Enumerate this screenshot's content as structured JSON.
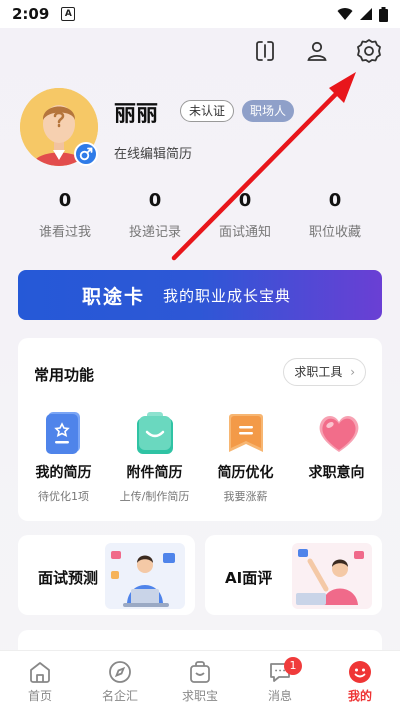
{
  "status": {
    "time": "2:09",
    "notification_letter": "A"
  },
  "header": {
    "icons": [
      "scan-icon",
      "user-icon",
      "settings-icon"
    ]
  },
  "profile": {
    "name": "丽丽",
    "tag_unverified": "未认证",
    "tag_pro": "职场人",
    "edit_resume": "在线编辑简历"
  },
  "stats": [
    {
      "value": "0",
      "label": "谁看过我"
    },
    {
      "value": "0",
      "label": "投递记录"
    },
    {
      "value": "0",
      "label": "面试通知"
    },
    {
      "value": "0",
      "label": "职位收藏"
    }
  ],
  "banner": {
    "title": "职途卡",
    "subtitle": "我的职业成长宝典"
  },
  "common": {
    "title": "常用功能",
    "tools_button": "求职工具",
    "items": [
      {
        "label": "我的简历",
        "sub": "待优化1项",
        "icon": "resume-icon",
        "color": "#5b8ef0"
      },
      {
        "label": "附件简历",
        "sub": "上传/制作简历",
        "icon": "attachment-resume-icon",
        "color": "#2ec2a5"
      },
      {
        "label": "简历优化",
        "sub": "我要涨薪",
        "icon": "resume-optimize-icon",
        "color": "#f5a04a"
      },
      {
        "label": "求职意向",
        "sub": "",
        "icon": "heart-icon",
        "color": "#f46b86"
      }
    ]
  },
  "mini_cards": [
    {
      "label": "面试预测"
    },
    {
      "label": "AI面评"
    }
  ],
  "tabbar": {
    "items": [
      {
        "label": "首页",
        "icon": "home-icon"
      },
      {
        "label": "名企汇",
        "icon": "compass-icon"
      },
      {
        "label": "求职宝",
        "icon": "bag-icon"
      },
      {
        "label": "消息",
        "icon": "message-icon",
        "badge": "1"
      },
      {
        "label": "我的",
        "icon": "smile-icon",
        "active": true
      }
    ]
  },
  "colors": {
    "accent": "#e33333",
    "banner_start": "#2559d7",
    "banner_end": "#6a3fd4",
    "arrow": "#e8161b"
  }
}
